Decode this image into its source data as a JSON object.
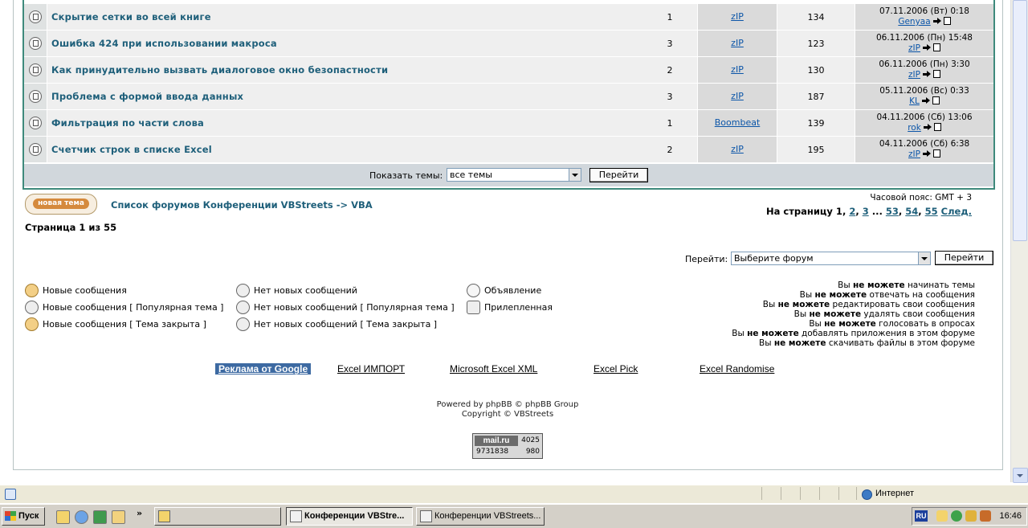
{
  "topics": [
    {
      "title": "Скрытие сетки во всей книге",
      "replies": "1",
      "author": "zIP",
      "views": "134",
      "last_date": "07.11.2006 (Вт) 0:18",
      "last_user": "Genyaa"
    },
    {
      "title": "Ошибка 424 при использовании макроса",
      "replies": "3",
      "author": "zIP",
      "views": "123",
      "last_date": "06.11.2006 (Пн) 15:48",
      "last_user": "zIP"
    },
    {
      "title": "Как принудительно вызвать диалоговое окно безопастности",
      "replies": "2",
      "author": "zIP",
      "views": "130",
      "last_date": "06.11.2006 (Пн) 3:30",
      "last_user": "zIP"
    },
    {
      "title": "Проблема с формой ввода данных",
      "replies": "3",
      "author": "zIP",
      "views": "187",
      "last_date": "05.11.2006 (Вс) 0:33",
      "last_user": "KL"
    },
    {
      "title": "Фильтрация по части слова",
      "replies": "1",
      "author": "Boombeat",
      "views": "139",
      "last_date": "04.11.2006 (Сб) 13:06",
      "last_user": "rok"
    },
    {
      "title": "Счетчик строк в списке Excel",
      "replies": "2",
      "author": "zIP",
      "views": "195",
      "last_date": "04.11.2006 (Сб) 6:38",
      "last_user": "zIP"
    }
  ],
  "filter": {
    "label": "Показать темы:",
    "value": "все темы",
    "button": "Перейти"
  },
  "new_topic_button": "новая тема",
  "breadcrumb": "Список форумов Конференции VBStreets -> VBA",
  "timezone": "Часовой пояс: GMT + 3",
  "pagination": {
    "prefix": "На страницу",
    "current": "1",
    "pages": [
      "2",
      "3"
    ],
    "ellipsis": "...",
    "last_pages": [
      "53",
      "54",
      "55"
    ],
    "next": "След."
  },
  "page_info": "Страница 1 из 55",
  "jump": {
    "label": "Перейти:",
    "value": "Выберите форум",
    "button": "Перейти"
  },
  "legend": [
    {
      "text": "Новые сообщения",
      "icon": "new-posts-icon"
    },
    {
      "text": "Новые сообщения [ Популярная тема ]",
      "icon": "new-posts-hot-icon"
    },
    {
      "text": "Новые сообщения [ Тема закрыта ]",
      "icon": "new-posts-locked-icon"
    },
    {
      "text": "Нет новых сообщений",
      "icon": "no-new-posts-icon"
    },
    {
      "text": "Нет новых сообщений [ Популярная тема ]",
      "icon": "no-new-posts-hot-icon"
    },
    {
      "text": "Нет новых сообщений [ Тема закрыта ]",
      "icon": "no-new-posts-locked-icon"
    },
    {
      "text": "Объявление",
      "icon": "announcement-icon"
    },
    {
      "text": "Прилепленная",
      "icon": "sticky-icon"
    }
  ],
  "permissions": [
    {
      "pre": "Вы",
      "bold": "не можете",
      "post": "начинать темы"
    },
    {
      "pre": "Вы",
      "bold": "не можете",
      "post": "отвечать на сообщения"
    },
    {
      "pre": "Вы",
      "bold": "не можете",
      "post": "редактировать свои сообщения"
    },
    {
      "pre": "Вы",
      "bold": "не можете",
      "post": "удалять свои сообщения"
    },
    {
      "pre": "Вы",
      "bold": "не можете",
      "post": "голосовать в опросах"
    },
    {
      "pre": "Вы",
      "bold": "не можете",
      "post": "добавлять приложения в этом форуме"
    },
    {
      "pre": "Вы",
      "bold": "не можете",
      "post": "скачивать файлы в этом форуме"
    }
  ],
  "ads": {
    "google": "Реклама от Google",
    "links": [
      "Excel ИМПОРТ",
      "Microsoft Excel XML",
      "Excel Pick",
      "Excel Randomise"
    ]
  },
  "footer": {
    "powered": "Powered by phpBB © phpBB Group",
    "copyright": "Copyright © VBStreets"
  },
  "counter": {
    "logo": "mail.ru",
    "v1": "4025",
    "v2": "9731838",
    "v3": "980"
  },
  "statusbar": {
    "zone": "Интернет"
  },
  "taskbar": {
    "start": "Пуск",
    "windows": [
      "Конференции VBStre...",
      "Конференции VBStreets..."
    ],
    "lang": "RU",
    "clock": "16:46"
  },
  "colors": {
    "accent": "#3e8a7c",
    "link": "#1e5f7a",
    "user_link": "#0b55a8",
    "filter_bar": "#d1d7dc"
  }
}
